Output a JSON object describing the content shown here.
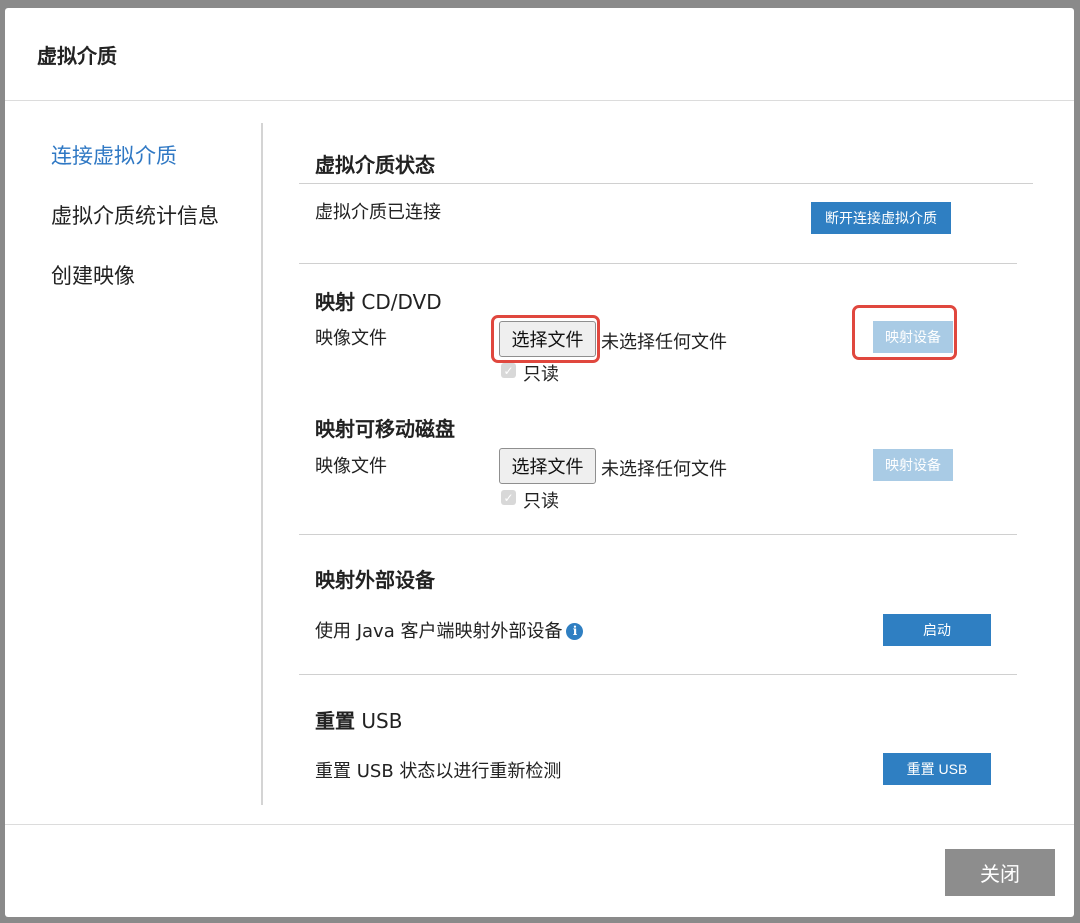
{
  "dialog": {
    "title": "虚拟介质"
  },
  "sidebar": {
    "items": [
      {
        "label": "连接虚拟介质"
      },
      {
        "label": "虚拟介质统计信息"
      },
      {
        "label": "创建映像"
      }
    ]
  },
  "status": {
    "title": "虚拟介质状态",
    "text": "虚拟介质已连接",
    "disconnect_label": "断开连接虚拟介质"
  },
  "cd_dvd": {
    "title_bold": "映射",
    "title_rest": " CD/DVD",
    "image_label": "映像文件",
    "choose_label": "选择文件",
    "no_file_text": "未选择任何文件",
    "readonly_label": "只读",
    "map_label": "映射设备"
  },
  "removable": {
    "title": "映射可移动磁盘",
    "image_label": "映像文件",
    "choose_label": "选择文件",
    "no_file_text": "未选择任何文件",
    "readonly_label": "只读",
    "map_label": "映射设备"
  },
  "external": {
    "title": "映射外部设备",
    "text": "使用 Java 客户端映射外部设备",
    "start_label": "启动",
    "info_glyph": "i"
  },
  "usb": {
    "title_bold": "重置",
    "title_rest": " USB",
    "text": "重置 USB 状态以进行重新检测",
    "reset_label": "重置 USB"
  },
  "footer": {
    "close_label": "关闭"
  },
  "colors": {
    "accent": "#2f7fc2",
    "active_nav": "#2f78c4",
    "disabled_button": "#a9cbe5",
    "highlight": "#e0473e",
    "close_button": "#8d8d8d"
  }
}
